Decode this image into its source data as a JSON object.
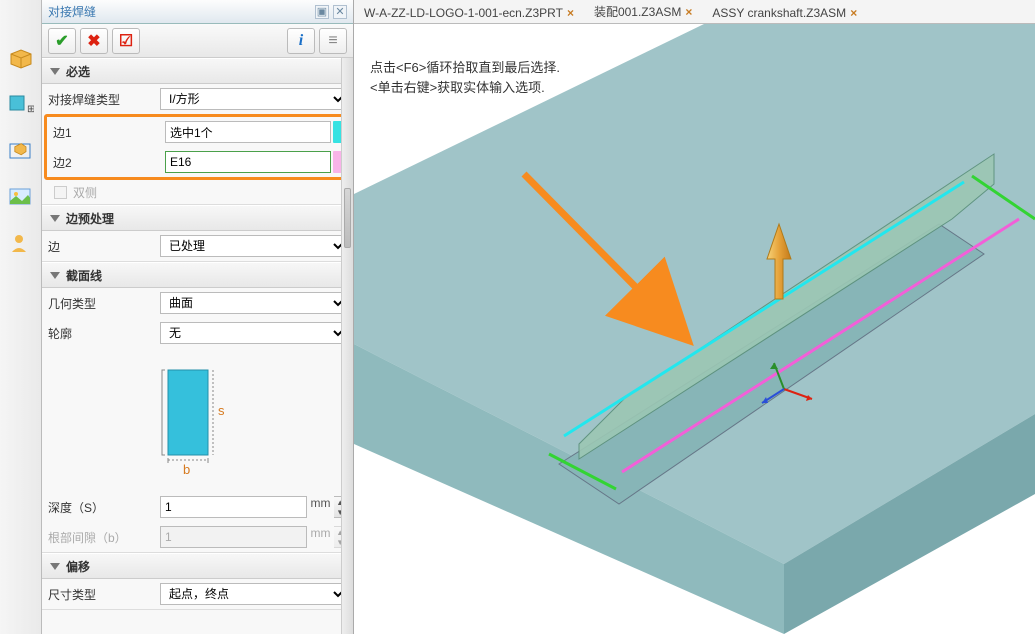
{
  "panel_title": "对接焊缝",
  "sections": {
    "required": {
      "title": "必选",
      "weld_type_label": "对接焊缝类型",
      "weld_type_value": "I/方形",
      "edge1_label": "边1",
      "edge1_value": "选中1个",
      "edge2_label": "边2",
      "edge2_value": "E16",
      "both_sides": "双侧"
    },
    "pre": {
      "title": "边预处理",
      "edge_label": "边",
      "edge_value": "已处理"
    },
    "section_line": {
      "title": "截面线",
      "geom_label": "几何类型",
      "geom_value": "曲面",
      "profile_label": "轮廓",
      "profile_value": "无",
      "depth_label": "深度（S）",
      "depth_value": "1",
      "gap_label": "根部间隙（b）",
      "gap_value": "1",
      "unit": "mm"
    },
    "offset": {
      "title": "偏移",
      "size_label": "尺寸类型",
      "size_value": "起点，终点"
    }
  },
  "tabs": [
    "W-A-ZZ-LD-LOGO-1-001-ecn.Z3PRT",
    "装配001.Z3ASM",
    "ASSY crankshaft.Z3ASM"
  ],
  "hints": {
    "l1": "点击<F6>循环拾取直到最后选择.",
    "l2": "<单击右键>获取实体输入选项."
  },
  "diagram_labels": {
    "s": "s",
    "b": "b"
  }
}
